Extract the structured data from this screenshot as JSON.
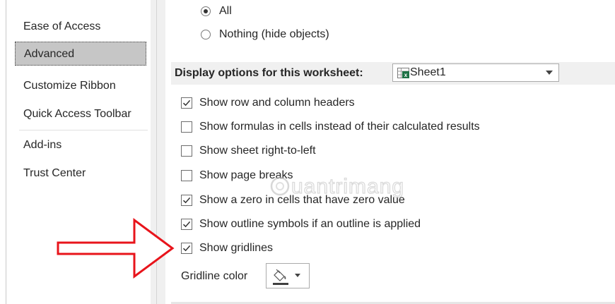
{
  "sidebar": {
    "items": [
      {
        "label": "Ease of Access",
        "selected": false
      },
      {
        "label": "Advanced",
        "selected": true
      },
      {
        "label": "Customize Ribbon",
        "selected": false
      },
      {
        "label": "Quick Access Toolbar",
        "selected": false
      },
      {
        "label": "Add-ins",
        "selected": false
      },
      {
        "label": "Trust Center",
        "selected": false
      }
    ]
  },
  "objects": {
    "options": [
      {
        "label": "All",
        "checked": true
      },
      {
        "label": "Nothing (hide objects)",
        "checked": false
      }
    ]
  },
  "worksheet_section": {
    "title": "Display options for this worksheet:",
    "selected_sheet": "Sheet1",
    "options": [
      {
        "label": "Show row and column headers",
        "checked": true
      },
      {
        "label": "Show formulas in cells instead of their calculated results",
        "checked": false
      },
      {
        "label": "Show sheet right-to-left",
        "checked": false
      },
      {
        "label": "Show page breaks",
        "checked": false
      },
      {
        "label": "Show a zero in cells that have zero value",
        "checked": true
      },
      {
        "label": "Show outline symbols if an outline is applied",
        "checked": true
      },
      {
        "label": "Show gridlines",
        "checked": true
      }
    ],
    "gridline_color_label": "Gridline color"
  },
  "watermark": "Quantrimang",
  "colors": {
    "selected_bg": "#c6c6c6",
    "section_bg": "#f0f0f0",
    "arrow": "#e8141b",
    "excel_green": "#1e7145"
  }
}
